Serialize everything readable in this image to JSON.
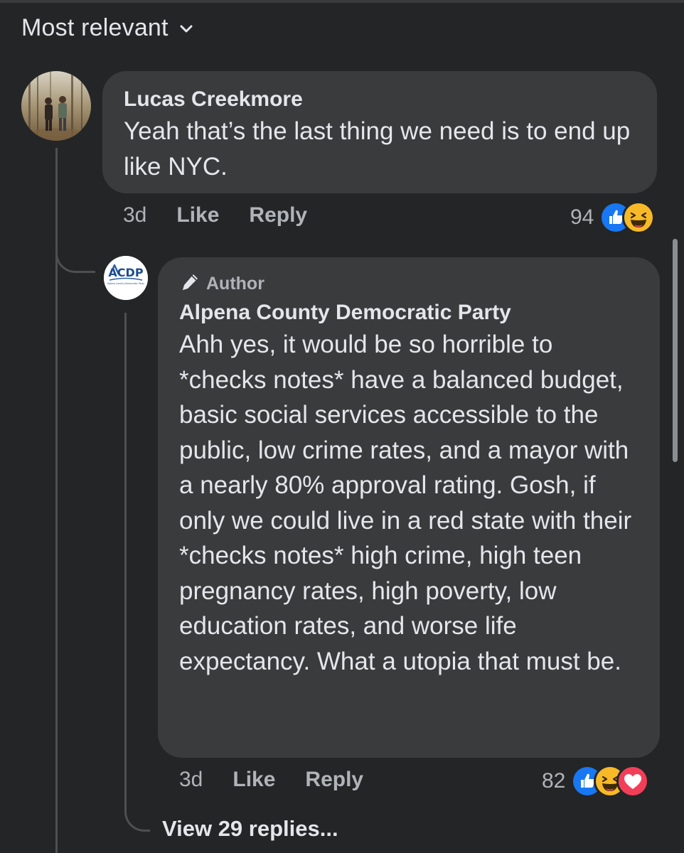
{
  "sort": {
    "label": "Most relevant"
  },
  "comments": [
    {
      "author": "Lucas Creekmore",
      "text": "Yeah that’s the last thing we need is to end up like NYC.",
      "time": "3d",
      "like_label": "Like",
      "reply_label": "Reply",
      "reaction_count": "94",
      "reactions": [
        "like-icon",
        "haha-icon"
      ]
    },
    {
      "badge": "Author",
      "author": "Alpena County Democratic Party",
      "avatar_logo_text": "ACDP",
      "avatar_logo_subtext": "Alpena County Democratic Party",
      "text": "Ahh yes, it would be so horrible to *checks notes* have a balanced budget, basic social services accessible to the public, low crime rates, and a mayor with a nearly 80% approval rating. Gosh, if only we could live in a red state with their *checks notes* high crime, high teen pregnancy rates, high poverty, low education rates, and worse life expectancy. What a utopia that must be.",
      "time": "3d",
      "like_label": "Like",
      "reply_label": "Reply",
      "reaction_count": "82",
      "reactions": [
        "like-icon",
        "haha-icon",
        "love-icon"
      ]
    }
  ],
  "view_replies": "View 29 replies...",
  "colors": {
    "background": "#242526",
    "bubble": "#3a3b3c",
    "primary_text": "#e4e6eb",
    "secondary_text": "#b0b3b8",
    "like_blue": "#1877f2",
    "haha_yellow": "#f7b928",
    "love_red": "#f33e58"
  }
}
